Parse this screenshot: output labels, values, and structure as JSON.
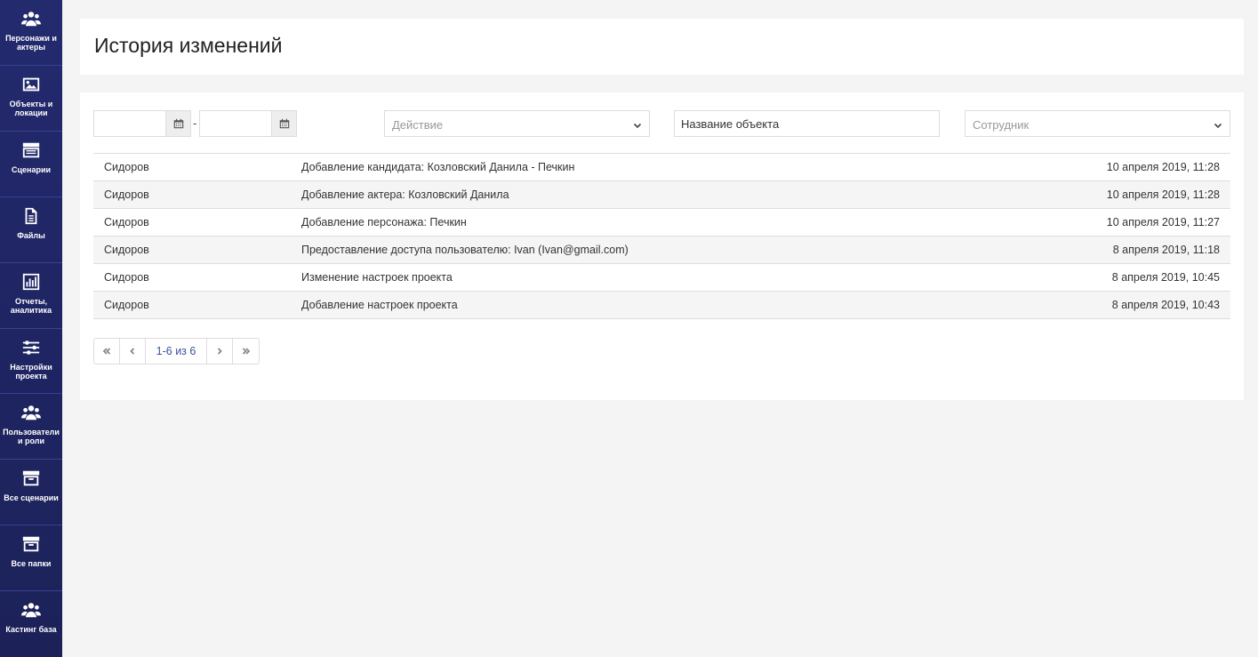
{
  "sidebar": {
    "items": [
      {
        "label": "Персонажи и актеры",
        "icon": "users-icon"
      },
      {
        "label": "Объекты и локации",
        "icon": "image-icon"
      },
      {
        "label": "Сценарии",
        "icon": "clapperboard-icon"
      },
      {
        "label": "Файлы",
        "icon": "file-icon"
      },
      {
        "label": "Отчеты, аналитика",
        "icon": "bar-chart-icon"
      },
      {
        "label": "Настройки проекта",
        "icon": "sliders-icon"
      },
      {
        "label": "Пользователи и роли",
        "icon": "users-icon"
      },
      {
        "label": "Все сценарии",
        "icon": "archive-icon"
      },
      {
        "label": "Все папки",
        "icon": "archive-icon"
      },
      {
        "label": "Кастинг база",
        "icon": "users-icon"
      }
    ]
  },
  "header": {
    "title": "История изменений"
  },
  "filters": {
    "date_from": "",
    "date_to": "",
    "date_separator": "-",
    "action_placeholder": "Действие",
    "object_name": "Название объекта",
    "employee_placeholder": "Сотрудник"
  },
  "table": {
    "rows": [
      {
        "user": "Сидоров",
        "action": "Добавление кандидата: Козловский Данила - Печкин",
        "date": "10 апреля 2019, 11:28"
      },
      {
        "user": "Сидоров",
        "action": "Добавление актера: Козловский Данила",
        "date": "10 апреля 2019, 11:28"
      },
      {
        "user": "Сидоров",
        "action": "Добавление персонажа: Печкин",
        "date": "10 апреля 2019, 11:27"
      },
      {
        "user": "Сидоров",
        "action": "Предоставление доступа пользователю: Ivan (Ivan@gmail.com)",
        "date": "8 апреля 2019, 11:18"
      },
      {
        "user": "Сидоров",
        "action": "Изменение настроек проекта",
        "date": "8 апреля 2019, 10:45"
      },
      {
        "user": "Сидоров",
        "action": "Добавление настроек проекта",
        "date": "8 апреля 2019, 10:43"
      }
    ]
  },
  "pagination": {
    "info": "1-6 из 6"
  },
  "colors": {
    "sidebar": "#232a6e",
    "accent": "#3a52a0",
    "background": "#f4f4f4"
  }
}
